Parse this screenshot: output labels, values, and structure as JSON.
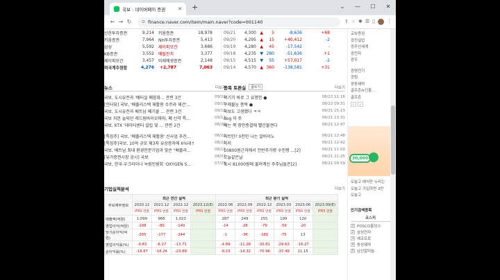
{
  "browser": {
    "tab_title": "국보 : 네이버페이 증권",
    "url": "finance.naver.com/item/main.naver?code=001140"
  },
  "trade_members": [
    {
      "sell": "신한투자증권",
      "sell_vol": "9,214",
      "buy": "키움증권",
      "buy_vol": "18,978"
    },
    {
      "sell": "키움증권",
      "sell_vol": "7,964",
      "buy": "NH투자증권",
      "buy_vol": "5,413"
    },
    {
      "sell": "삼성",
      "sell_vol": "5,592",
      "buy": "제이피모간",
      "buy_vol": "3,686"
    },
    {
      "sell": "KB증권",
      "sell_vol": "3,552",
      "buy": "메릴린치",
      "buy_vol": "3,377"
    },
    {
      "sell": "제이피모간",
      "sell_vol": "3,457",
      "buy": "미래에셋증권",
      "buy_vol": "2,148"
    }
  ],
  "foreign_total": {
    "label": "외국계추정합",
    "sell": "4,276",
    "change": "+2,787",
    "buy": "7,063"
  },
  "daily_prices": [
    {
      "date": "09/21",
      "price": "4,300",
      "arrow": "▲",
      "chg": "5",
      "vol": "-8,636",
      "inst": "+68"
    },
    {
      "date": "09/20",
      "price": "4,295",
      "arrow": "▲",
      "chg": "15",
      "vol": "+40,412",
      "inst": "-2"
    },
    {
      "date": "09/19",
      "price": "4,280",
      "arrow": "▲",
      "chg": "45",
      "vol": "-17,542",
      "inst": "-"
    },
    {
      "date": "09/18",
      "price": "4,235",
      "arrow": "▼",
      "chg": "280",
      "vol": "-51,636",
      "inst": "+1"
    },
    {
      "date": "09/15",
      "price": "4,515",
      "arrow": "▼",
      "chg": "55",
      "vol": "+57,017",
      "inst": "-2"
    },
    {
      "date": "09/14",
      "price": "4,570",
      "arrow": "▲",
      "chg": "360",
      "vol": "-138,581",
      "inst": "+31"
    }
  ],
  "news": {
    "title": "뉴스",
    "more": "더보기",
    "group1": [
      {
        "t": "국보, 도시유전과 '배터실 폐음화...  관련 3건",
        "d": "09/21"
      },
      {
        "t": "[인터뷰] 국보, '배출리스텍 재활용 수르라 재건'...",
        "d": "09/19"
      },
      {
        "t": "국보, 도시유전과 베트남 폐기물 ...  관련 3건",
        "d": "09/18"
      },
      {
        "t": "국보 자본 늘되던 레드림바이오파마, 폐 신약 특...",
        "d": "09/11"
      },
      {
        "t": "국보, KTX '데이터센터 설립 및 ...   관련 2건",
        "d": "08/29"
      }
    ],
    "group2": [
      {
        "t": "[특징주] 국보, '배출리스텍 재활용' 신사업 추진...",
        "d": "08/23"
      },
      {
        "t": "[특징주]국보, 10억 규모 제3자 유상증자에 6%대↑",
        "d": "08/23"
      },
      {
        "t": "국보, 베트남 최대 환경전문기업과 맞손 \"배출라...",
        "d": "08/18"
      },
      {
        "t": "[유가증권시장 공시] 국보",
        "d": "08/07"
      },
      {
        "t": "국보, 한국-우크라이나 녹림인원회 'OXYGEN S...",
        "d": "07/25"
      }
    ]
  },
  "board": {
    "title": "종목 토론실",
    "write": "글쓰기",
    "more": "더보기",
    "group1": [
      {
        "t": "여기가 바로 그 유명한 ●",
        "d": "09/22 11:16"
      },
      {
        "t": "구제불능 종목 ●",
        "d": "09/22 09:31"
      },
      {
        "t": "국보도 고생했다 ㅋㅋ",
        "d": "09/21 15:23"
      },
      {
        "t": "dog 이 주",
        "d": "09/21 13:31"
      },
      {
        "t": "배는 쪽 장안종결에 빨간불켠다",
        "d": "09/21 12:47"
      }
    ],
    "group2": [
      {
        "t": "어트만? 0천인 나는 알바이노",
        "d": "09/21 12:48"
      },
      {
        "t": "이저",
        "d": "09/21 12:42"
      },
      {
        "t": "10800원근처에서 전반주가량 수전쟁 ...[2]",
        "d": "09/21 11:50"
      },
      {
        "t": "오늘같은날",
        "d": "09/21 11:25"
      },
      {
        "t": "혹시 81000원에 물려계신 주주님들은[2]",
        "d": "09/21 09:59"
      }
    ]
  },
  "financials": {
    "title": "기업실적분석",
    "more": "더보기",
    "col_header": "주요재무정보",
    "annual_label": "최근 연간 실적",
    "quarter_label": "최근 분기 실적",
    "annual_periods": [
      "2020.12",
      "2021.12",
      "2022.12",
      "2023.12(E)"
    ],
    "quarter_periods": [
      "2022.06",
      "2022.09",
      "2022.12",
      "2023.03",
      "2023.06",
      "2023.09(E)"
    ],
    "ifrs": "IFRS 연결",
    "rows": [
      {
        "label": "매출액(억원)",
        "a": [
          "1,099",
          "968",
          "1,023",
          ""
        ],
        "q": [
          "287",
          "249",
          "255",
          "199",
          "120",
          ""
        ]
      },
      {
        "label": "영업이익(억원)",
        "a": [
          "-108",
          "-80",
          "-140",
          ""
        ],
        "q": [
          "-14",
          "-28",
          "-79",
          "-59",
          "-20",
          ""
        ]
      },
      {
        "label": "당기순이익(억원)",
        "a": [
          "-205",
          "-177",
          "-244",
          ""
        ],
        "q": [
          "-1",
          "-36",
          "-181",
          "-75",
          "13",
          ""
        ]
      },
      {
        "label": "영업이익률(%)",
        "a": [
          "-9.83",
          "-8.27",
          "-13.71",
          ""
        ],
        "q": [
          "-4.89",
          "-11.28",
          "-30.81",
          "-29.63",
          "-16.27",
          ""
        ]
      },
      {
        "label": "순이익률(%)",
        "a": [
          "-18.67",
          "-18.24",
          "-23.89",
          ""
        ],
        "q": [
          "-0.23",
          "-14.32",
          "-70.96",
          "-37.49",
          "11.15",
          ""
        ]
      }
    ]
  },
  "sidebar": {
    "items1": [
      "교보증권",
      "광진실업",
      "광주신세계",
      "광전자",
      "광우"
    ],
    "items2": [
      "광명전기",
      "광림",
      "광동제약",
      "골프존뉴딘홀...",
      "골프존"
    ],
    "ad_badge": "30,000",
    "ad_text": [
      "오늘고 예식만 누리는",
      "오늘고 가입하면 3만",
      "오늘고"
    ],
    "popular_title": "인기검색종목",
    "popular_tab": "코스피",
    "popular": [
      "POSCO홀딩스",
      "삼성전자",
      "에코프로",
      "동성제약",
      "남선알미늄"
    ]
  }
}
